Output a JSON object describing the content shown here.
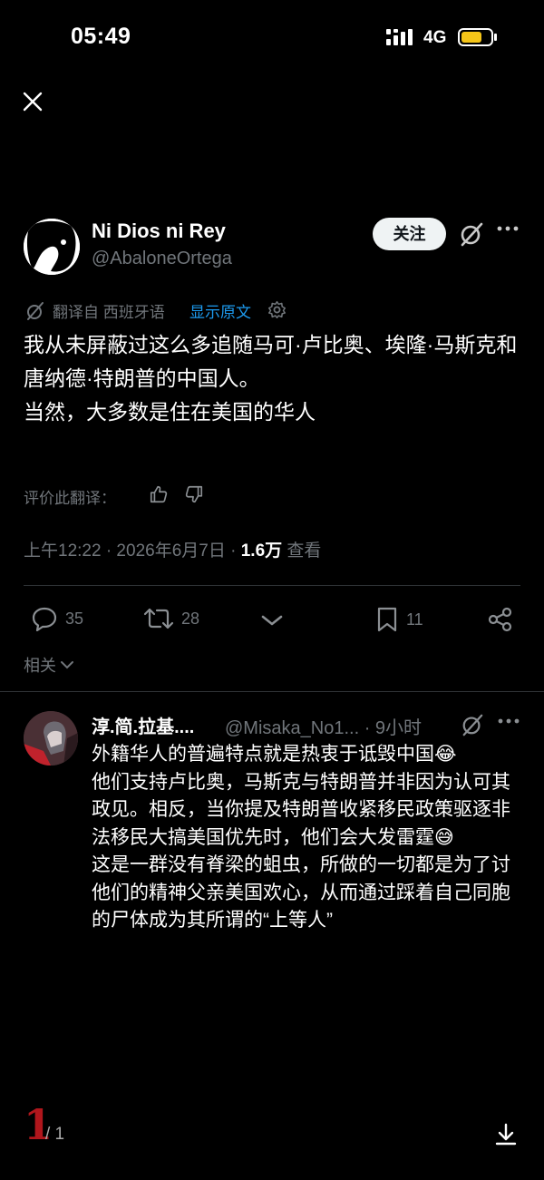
{
  "status_bar": {
    "time": "05:49",
    "network": "4G",
    "colors": {
      "battery": "#f5c518"
    }
  },
  "header": {
    "close_icon": "close-icon"
  },
  "tweet": {
    "author_name": "Ni Dios ni Rey",
    "author_handle": "@AbaloneOrtega",
    "follow_label": "关注",
    "translated_from": "翻译自 西班牙语",
    "show_original": "显示原文",
    "text": "我从未屏蔽过这么多追随马可·卢比奥、埃隆·马斯克和唐纳德·特朗普的中国人。\n当然，大多数是住在美国的华人",
    "rate_label": "评价此翻译：",
    "time_date": "上午12:22 · 2026年6月7日 · ",
    "views_count": "1.6万",
    "views_label": " 查看",
    "replies": "35",
    "retweets": "28",
    "bookmarks": "11",
    "related_label": "相关"
  },
  "reply": {
    "author_name": "淳.简.拉基....",
    "author_handle": "@Misaka_No1... · 9小时",
    "text": "外籍华人的普遍特点就是热衷于诋毁中国😂\n他们支持卢比奥，马斯克与特朗普并非因为认可其政见。相反，当你提及特朗普收紧移民政策驱逐非法移民大搞美国优先时，他们会大发雷霆😅\n这是一群没有脊梁的蛆虫，所做的一切都是为了讨他们的精神父亲美国欢心，从而通过踩着自己同胞的尸体成为其所谓的“上等人”"
  },
  "pager": {
    "current": "1",
    "total": "/ 1"
  },
  "colors": {
    "accent": "#1d9bf0",
    "page_current": "#b0161c"
  }
}
